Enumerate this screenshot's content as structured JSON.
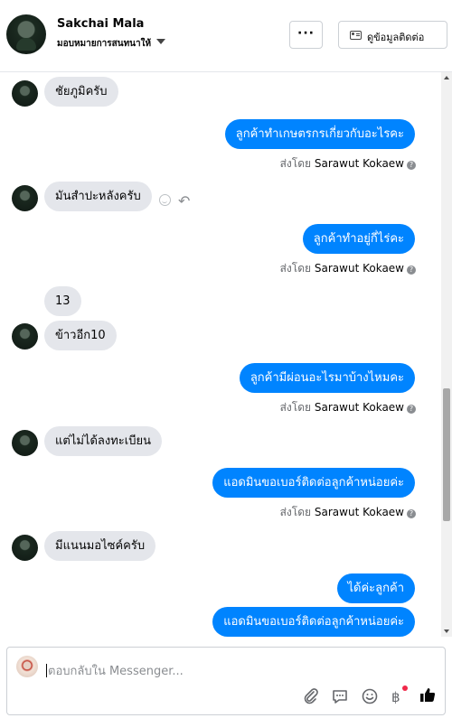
{
  "header": {
    "name": "Sakchai Mala",
    "assigned": "มอบหมายการสนทนาให้",
    "more_label": "···",
    "contact_label": "ดูข้อมูลติดต่อ"
  },
  "messages": [
    {
      "dir": "in",
      "text": "ชัยภูมิครับ"
    },
    {
      "dir": "out",
      "text": "ลูกค้าทำเกษตรกรเกี่ยวกับอะไรคะ",
      "sent_prefix": "ส่งโดย",
      "sent_by": "Sarawut Kokaew"
    },
    {
      "dir": "in",
      "text": "มันสำปะหลังครับ"
    },
    {
      "dir": "out",
      "text": "ลูกค้าทำอยู่กี่ไร่คะ",
      "sent_prefix": "ส่งโดย",
      "sent_by": "Sarawut Kokaew"
    },
    {
      "dir": "in",
      "text": "13"
    },
    {
      "dir": "in",
      "text": "ข้าวอีก10"
    },
    {
      "dir": "out",
      "text": "ลูกค้ามีผ่อนอะไรมาบ้างไหมคะ",
      "sent_prefix": "ส่งโดย",
      "sent_by": "Sarawut Kokaew"
    },
    {
      "dir": "in",
      "text": "แต่ไม่ได้ลงทะเบียน"
    },
    {
      "dir": "out",
      "text": "แอดมินขอเบอร์ติดต่อลูกค้าหน่อยค่ะ",
      "sent_prefix": "ส่งโดย",
      "sent_by": "Sarawut Kokaew"
    },
    {
      "dir": "in",
      "text": "มีแนนมอไซค์ครับ"
    },
    {
      "dir": "out",
      "text": "ได้ค่ะลูกค้า"
    },
    {
      "dir": "out",
      "text": "แอดมินขอเบอร์ติดต่อลูกค้าหน่อยค่ะ"
    }
  ],
  "composer": {
    "placeholder": "ตอบกลับใน Messenger...",
    "currency_symbol": "฿"
  },
  "icons": [
    "more-icon",
    "contact-card-icon",
    "emoji-icon",
    "reply-icon",
    "attach-icon",
    "message-template-icon",
    "sticker-icon",
    "payment-icon",
    "like-icon"
  ],
  "colors": {
    "outgoing_bubble": "#0084ff",
    "incoming_bubble": "#e4e6eb",
    "notify_dot": "#f02849"
  }
}
